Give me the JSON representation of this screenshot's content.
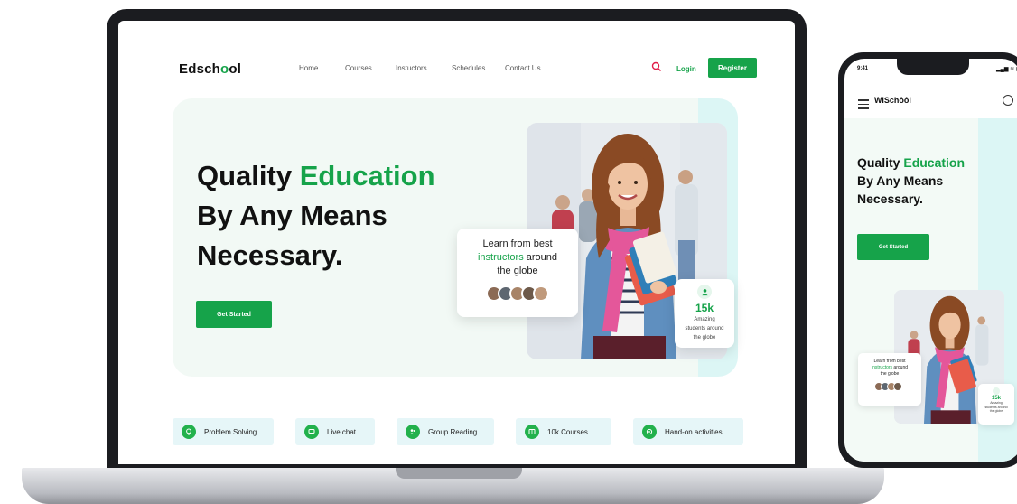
{
  "laptop": {
    "logo_prefix": "Edsch",
    "logo_o": "o",
    "logo_suffix": "ol",
    "nav": [
      "Home",
      "Courses",
      "Instuctors",
      "Schedules",
      "Contact Us"
    ],
    "login_label": "Login",
    "register_label": "Register",
    "hero": {
      "title_line1_a": "Quality ",
      "title_line1_b": "Education",
      "title_line2": "By Any Means",
      "title_line3": "Necessary.",
      "cta_label": "Get Started"
    },
    "learn_card": {
      "line1": "Learn from best",
      "line2_highlight": "instructors",
      "line2_rest": " around",
      "line3": "the globe"
    },
    "stat_card": {
      "value": "15k",
      "line1": "Amazing",
      "line2": "students around",
      "line3": "the globe"
    },
    "features": [
      {
        "label": "Problem Solving",
        "icon": "lightbulb-icon"
      },
      {
        "label": "Live chat",
        "icon": "chat-icon"
      },
      {
        "label": "Group Reading",
        "icon": "group-icon"
      },
      {
        "label": "10k Courses",
        "icon": "book-icon"
      },
      {
        "label": "Hand-on activities",
        "icon": "hands-icon"
      }
    ]
  },
  "phone": {
    "time": "9:41",
    "status": "▂▄▆ ≋ ▮",
    "logo": "WiSchôôl",
    "hero": {
      "title_line1_a": "Quality ",
      "title_line1_b": "Education",
      "title_line2": "By Any Means",
      "title_line3": "Necessary.",
      "cta_label": "Get Started"
    },
    "learn_card": {
      "line1": "Learn from best",
      "line2_highlight": "instructors",
      "line2_rest": " around",
      "line3": "the globe"
    },
    "stat_card": {
      "value": "15k",
      "line1": "Amazing",
      "line2": "students around",
      "line3": "the globe"
    }
  },
  "colors": {
    "accent": "#16a34a",
    "hero_bg": "#f2f9f5",
    "feature_bg": "#e6f6f8",
    "device": "#1b1c20"
  }
}
